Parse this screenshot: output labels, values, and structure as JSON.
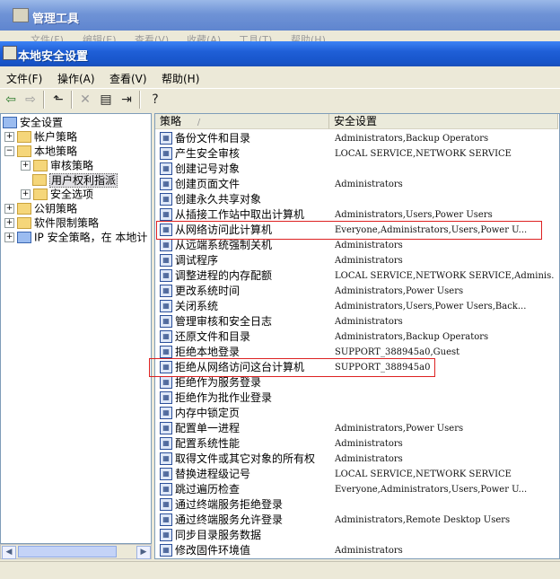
{
  "background_window": {
    "title": "管理工具",
    "menu": [
      "文件(F)",
      "编辑(E)",
      "查看(V)",
      "收藏(A)",
      "工具(T)",
      "帮助(H)"
    ]
  },
  "window": {
    "title": "本地安全设置",
    "menu": [
      "文件(F)",
      "操作(A)",
      "查看(V)",
      "帮助(H)"
    ]
  },
  "toolbar_icons": [
    "back-arrow-icon",
    "forward-arrow-icon",
    "up-folder-icon",
    "delete-icon",
    "properties-icon",
    "export-list-icon",
    "help-icon"
  ],
  "tree": {
    "root": "安全设置",
    "nodes": [
      {
        "label": "帐户策略",
        "expander": "+"
      },
      {
        "label": "本地策略",
        "expander": "−"
      },
      {
        "label": "审核策略",
        "expander": "+"
      },
      {
        "label": "用户权利指派",
        "expander": ""
      },
      {
        "label": "安全选项",
        "expander": "+"
      },
      {
        "label": "公钥策略",
        "expander": "+"
      },
      {
        "label": "软件限制策略",
        "expander": "+"
      },
      {
        "label": "IP 安全策略，在 本地计",
        "expander": "+"
      }
    ],
    "selected": "用户权利指派"
  },
  "columns": {
    "policy": "策略",
    "sort_indicator": "/",
    "setting": "安全设置"
  },
  "rows": [
    {
      "policy": "备份文件和目录",
      "setting": "Administrators,Backup Operators"
    },
    {
      "policy": "产生安全审核",
      "setting": "LOCAL SERVICE,NETWORK SERVICE"
    },
    {
      "policy": "创建记号对象",
      "setting": ""
    },
    {
      "policy": "创建页面文件",
      "setting": "Administrators"
    },
    {
      "policy": "创建永久共享对象",
      "setting": ""
    },
    {
      "policy": "从插接工作站中取出计算机",
      "setting": "Administrators,Users,Power Users"
    },
    {
      "policy": "从网络访问此计算机",
      "setting": "Everyone,Administrators,Users,Power U..."
    },
    {
      "policy": "从远端系统强制关机",
      "setting": "Administrators"
    },
    {
      "policy": "调试程序",
      "setting": "Administrators"
    },
    {
      "policy": "调整进程的内存配额",
      "setting": "LOCAL SERVICE,NETWORK SERVICE,Adminis..."
    },
    {
      "policy": "更改系统时间",
      "setting": "Administrators,Power Users"
    },
    {
      "policy": "关闭系统",
      "setting": "Administrators,Users,Power Users,Back..."
    },
    {
      "policy": "管理审核和安全日志",
      "setting": "Administrators"
    },
    {
      "policy": "还原文件和目录",
      "setting": "Administrators,Backup Operators"
    },
    {
      "policy": "拒绝本地登录",
      "setting": "SUPPORT_388945a0,Guest"
    },
    {
      "policy": "拒绝从网络访问这台计算机",
      "setting": "SUPPORT_388945a0"
    },
    {
      "policy": "拒绝作为服务登录",
      "setting": ""
    },
    {
      "policy": "拒绝作为批作业登录",
      "setting": ""
    },
    {
      "policy": "内存中锁定页",
      "setting": ""
    },
    {
      "policy": "配置单一进程",
      "setting": "Administrators,Power Users"
    },
    {
      "policy": "配置系统性能",
      "setting": "Administrators"
    },
    {
      "policy": "取得文件或其它对象的所有权",
      "setting": "Administrators"
    },
    {
      "policy": "替换进程级记号",
      "setting": "LOCAL SERVICE,NETWORK SERVICE"
    },
    {
      "policy": "跳过遍历检查",
      "setting": "Everyone,Administrators,Users,Power U..."
    },
    {
      "policy": "通过终端服务拒绝登录",
      "setting": ""
    },
    {
      "policy": "通过终端服务允许登录",
      "setting": "Administrators,Remote Desktop Users"
    },
    {
      "policy": "同步目录服务数据",
      "setting": ""
    },
    {
      "policy": "修改固件环境值",
      "setting": "Administrators"
    }
  ],
  "highlighted_rows": [
    6,
    15
  ],
  "colors": {
    "highlight_box": "#dd2222",
    "titlebar": "#1f5fd7"
  }
}
